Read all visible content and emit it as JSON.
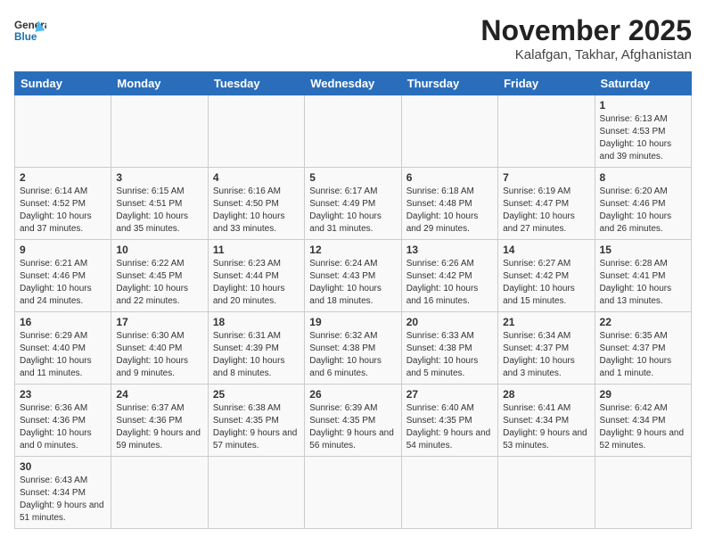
{
  "logo": {
    "text_general": "General",
    "text_blue": "Blue"
  },
  "title": {
    "month": "November 2025",
    "location": "Kalafgan, Takhar, Afghanistan"
  },
  "weekdays": [
    "Sunday",
    "Monday",
    "Tuesday",
    "Wednesday",
    "Thursday",
    "Friday",
    "Saturday"
  ],
  "days": [
    {
      "date": "",
      "info": ""
    },
    {
      "date": "",
      "info": ""
    },
    {
      "date": "",
      "info": ""
    },
    {
      "date": "",
      "info": ""
    },
    {
      "date": "",
      "info": ""
    },
    {
      "date": "",
      "info": ""
    },
    {
      "date": "1",
      "info": "Sunrise: 6:13 AM\nSunset: 4:53 PM\nDaylight: 10 hours and 39 minutes."
    },
    {
      "date": "2",
      "info": "Sunrise: 6:14 AM\nSunset: 4:52 PM\nDaylight: 10 hours and 37 minutes."
    },
    {
      "date": "3",
      "info": "Sunrise: 6:15 AM\nSunset: 4:51 PM\nDaylight: 10 hours and 35 minutes."
    },
    {
      "date": "4",
      "info": "Sunrise: 6:16 AM\nSunset: 4:50 PM\nDaylight: 10 hours and 33 minutes."
    },
    {
      "date": "5",
      "info": "Sunrise: 6:17 AM\nSunset: 4:49 PM\nDaylight: 10 hours and 31 minutes."
    },
    {
      "date": "6",
      "info": "Sunrise: 6:18 AM\nSunset: 4:48 PM\nDaylight: 10 hours and 29 minutes."
    },
    {
      "date": "7",
      "info": "Sunrise: 6:19 AM\nSunset: 4:47 PM\nDaylight: 10 hours and 27 minutes."
    },
    {
      "date": "8",
      "info": "Sunrise: 6:20 AM\nSunset: 4:46 PM\nDaylight: 10 hours and 26 minutes."
    },
    {
      "date": "9",
      "info": "Sunrise: 6:21 AM\nSunset: 4:46 PM\nDaylight: 10 hours and 24 minutes."
    },
    {
      "date": "10",
      "info": "Sunrise: 6:22 AM\nSunset: 4:45 PM\nDaylight: 10 hours and 22 minutes."
    },
    {
      "date": "11",
      "info": "Sunrise: 6:23 AM\nSunset: 4:44 PM\nDaylight: 10 hours and 20 minutes."
    },
    {
      "date": "12",
      "info": "Sunrise: 6:24 AM\nSunset: 4:43 PM\nDaylight: 10 hours and 18 minutes."
    },
    {
      "date": "13",
      "info": "Sunrise: 6:26 AM\nSunset: 4:42 PM\nDaylight: 10 hours and 16 minutes."
    },
    {
      "date": "14",
      "info": "Sunrise: 6:27 AM\nSunset: 4:42 PM\nDaylight: 10 hours and 15 minutes."
    },
    {
      "date": "15",
      "info": "Sunrise: 6:28 AM\nSunset: 4:41 PM\nDaylight: 10 hours and 13 minutes."
    },
    {
      "date": "16",
      "info": "Sunrise: 6:29 AM\nSunset: 4:40 PM\nDaylight: 10 hours and 11 minutes."
    },
    {
      "date": "17",
      "info": "Sunrise: 6:30 AM\nSunset: 4:40 PM\nDaylight: 10 hours and 9 minutes."
    },
    {
      "date": "18",
      "info": "Sunrise: 6:31 AM\nSunset: 4:39 PM\nDaylight: 10 hours and 8 minutes."
    },
    {
      "date": "19",
      "info": "Sunrise: 6:32 AM\nSunset: 4:38 PM\nDaylight: 10 hours and 6 minutes."
    },
    {
      "date": "20",
      "info": "Sunrise: 6:33 AM\nSunset: 4:38 PM\nDaylight: 10 hours and 5 minutes."
    },
    {
      "date": "21",
      "info": "Sunrise: 6:34 AM\nSunset: 4:37 PM\nDaylight: 10 hours and 3 minutes."
    },
    {
      "date": "22",
      "info": "Sunrise: 6:35 AM\nSunset: 4:37 PM\nDaylight: 10 hours and 1 minute."
    },
    {
      "date": "23",
      "info": "Sunrise: 6:36 AM\nSunset: 4:36 PM\nDaylight: 10 hours and 0 minutes."
    },
    {
      "date": "24",
      "info": "Sunrise: 6:37 AM\nSunset: 4:36 PM\nDaylight: 9 hours and 59 minutes."
    },
    {
      "date": "25",
      "info": "Sunrise: 6:38 AM\nSunset: 4:35 PM\nDaylight: 9 hours and 57 minutes."
    },
    {
      "date": "26",
      "info": "Sunrise: 6:39 AM\nSunset: 4:35 PM\nDaylight: 9 hours and 56 minutes."
    },
    {
      "date": "27",
      "info": "Sunrise: 6:40 AM\nSunset: 4:35 PM\nDaylight: 9 hours and 54 minutes."
    },
    {
      "date": "28",
      "info": "Sunrise: 6:41 AM\nSunset: 4:34 PM\nDaylight: 9 hours and 53 minutes."
    },
    {
      "date": "29",
      "info": "Sunrise: 6:42 AM\nSunset: 4:34 PM\nDaylight: 9 hours and 52 minutes."
    },
    {
      "date": "30",
      "info": "Sunrise: 6:43 AM\nSunset: 4:34 PM\nDaylight: 9 hours and 51 minutes."
    },
    {
      "date": "",
      "info": ""
    },
    {
      "date": "",
      "info": ""
    },
    {
      "date": "",
      "info": ""
    },
    {
      "date": "",
      "info": ""
    },
    {
      "date": "",
      "info": ""
    },
    {
      "date": "",
      "info": ""
    }
  ]
}
